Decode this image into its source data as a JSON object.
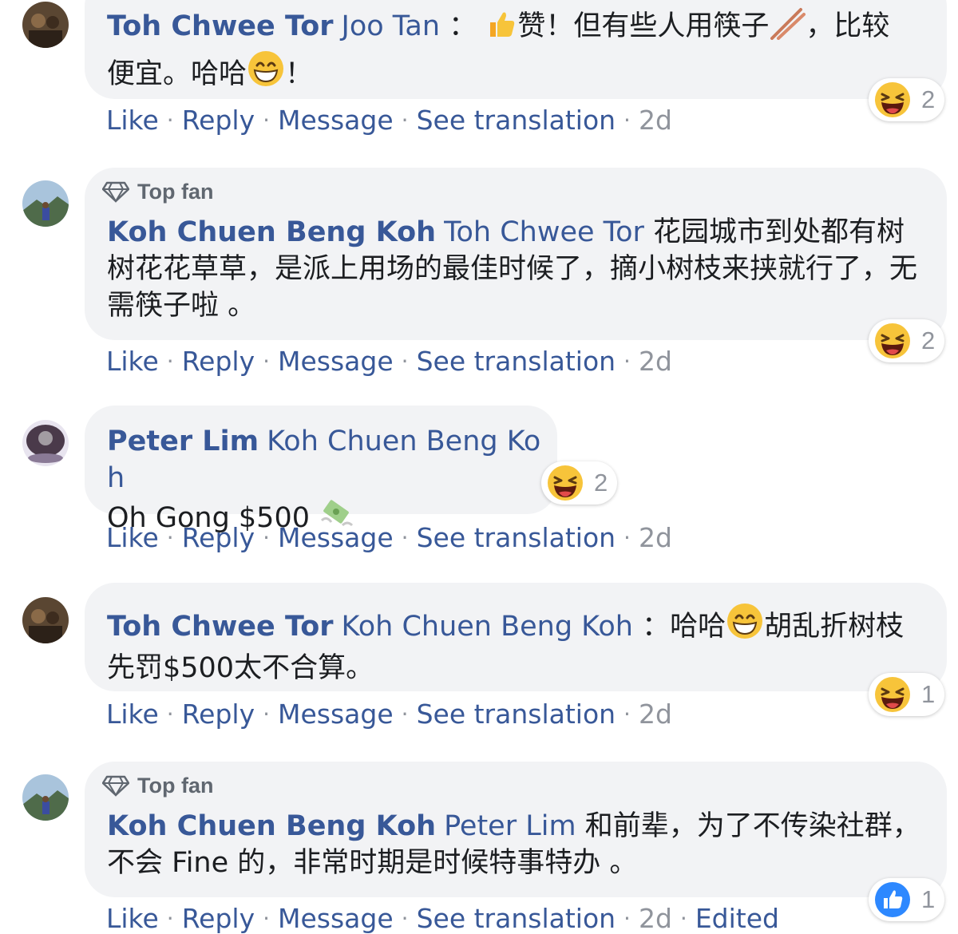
{
  "comments": [
    {
      "author": "Toh Chwee Tor",
      "mention": "Joo Tan",
      "text_a": "：",
      "text_b": "赞！但有些人用筷子",
      "text_c": "，比较便宜。哈哈",
      "text_d": "！",
      "top_fan": "",
      "reaction": {
        "icon": "laughing-emoji",
        "count": "2"
      },
      "actions": {
        "like": "Like",
        "reply": "Reply",
        "message": "Message",
        "translate": "See translation",
        "time": "2d",
        "edited": ""
      }
    },
    {
      "author": "Koh Chuen Beng Koh",
      "mention": "Toh Chwee Tor",
      "text_a": "花园城市到处都有树树花花草草，是派上用场的最佳时候了，摘小树枝来挟就行了，无需筷子啦 。",
      "top_fan": "Top fan",
      "reaction": {
        "icon": "laughing-emoji",
        "count": "2"
      },
      "actions": {
        "like": "Like",
        "reply": "Reply",
        "message": "Message",
        "translate": "See translation",
        "time": "2d",
        "edited": ""
      }
    },
    {
      "author": "Peter Lim",
      "mention": "Koh Chuen Beng Koh",
      "text_a": "Oh Gong $500",
      "top_fan": "",
      "reaction": {
        "icon": "laughing-emoji",
        "count": "2"
      },
      "actions": {
        "like": "Like",
        "reply": "Reply",
        "message": "Message",
        "translate": "See translation",
        "time": "2d",
        "edited": ""
      }
    },
    {
      "author": "Toh Chwee Tor",
      "mention": "Koh Chuen Beng Koh",
      "text_a": "：哈哈",
      "text_b": "胡乱折树枝先罚$500太不合算。",
      "top_fan": "",
      "reaction": {
        "icon": "laughing-emoji",
        "count": "1"
      },
      "actions": {
        "like": "Like",
        "reply": "Reply",
        "message": "Message",
        "translate": "See translation",
        "time": "2d",
        "edited": ""
      }
    },
    {
      "author": "Koh Chuen Beng Koh",
      "mention": "Peter Lim",
      "text_a": "和前辈，为了不传染社群，不会 Fine 的，非常时期是时候特事特办 。",
      "top_fan": "Top fan",
      "reaction": {
        "icon": "like-thumbs-up",
        "count": "1"
      },
      "actions": {
        "like": "Like",
        "reply": "Reply",
        "message": "Message",
        "translate": "See translation",
        "time": "2d",
        "edited": "Edited"
      }
    }
  ],
  "separator": "·",
  "colors": {
    "link": "#385898",
    "bubble": "#f2f3f5",
    "meta": "#90949c"
  }
}
